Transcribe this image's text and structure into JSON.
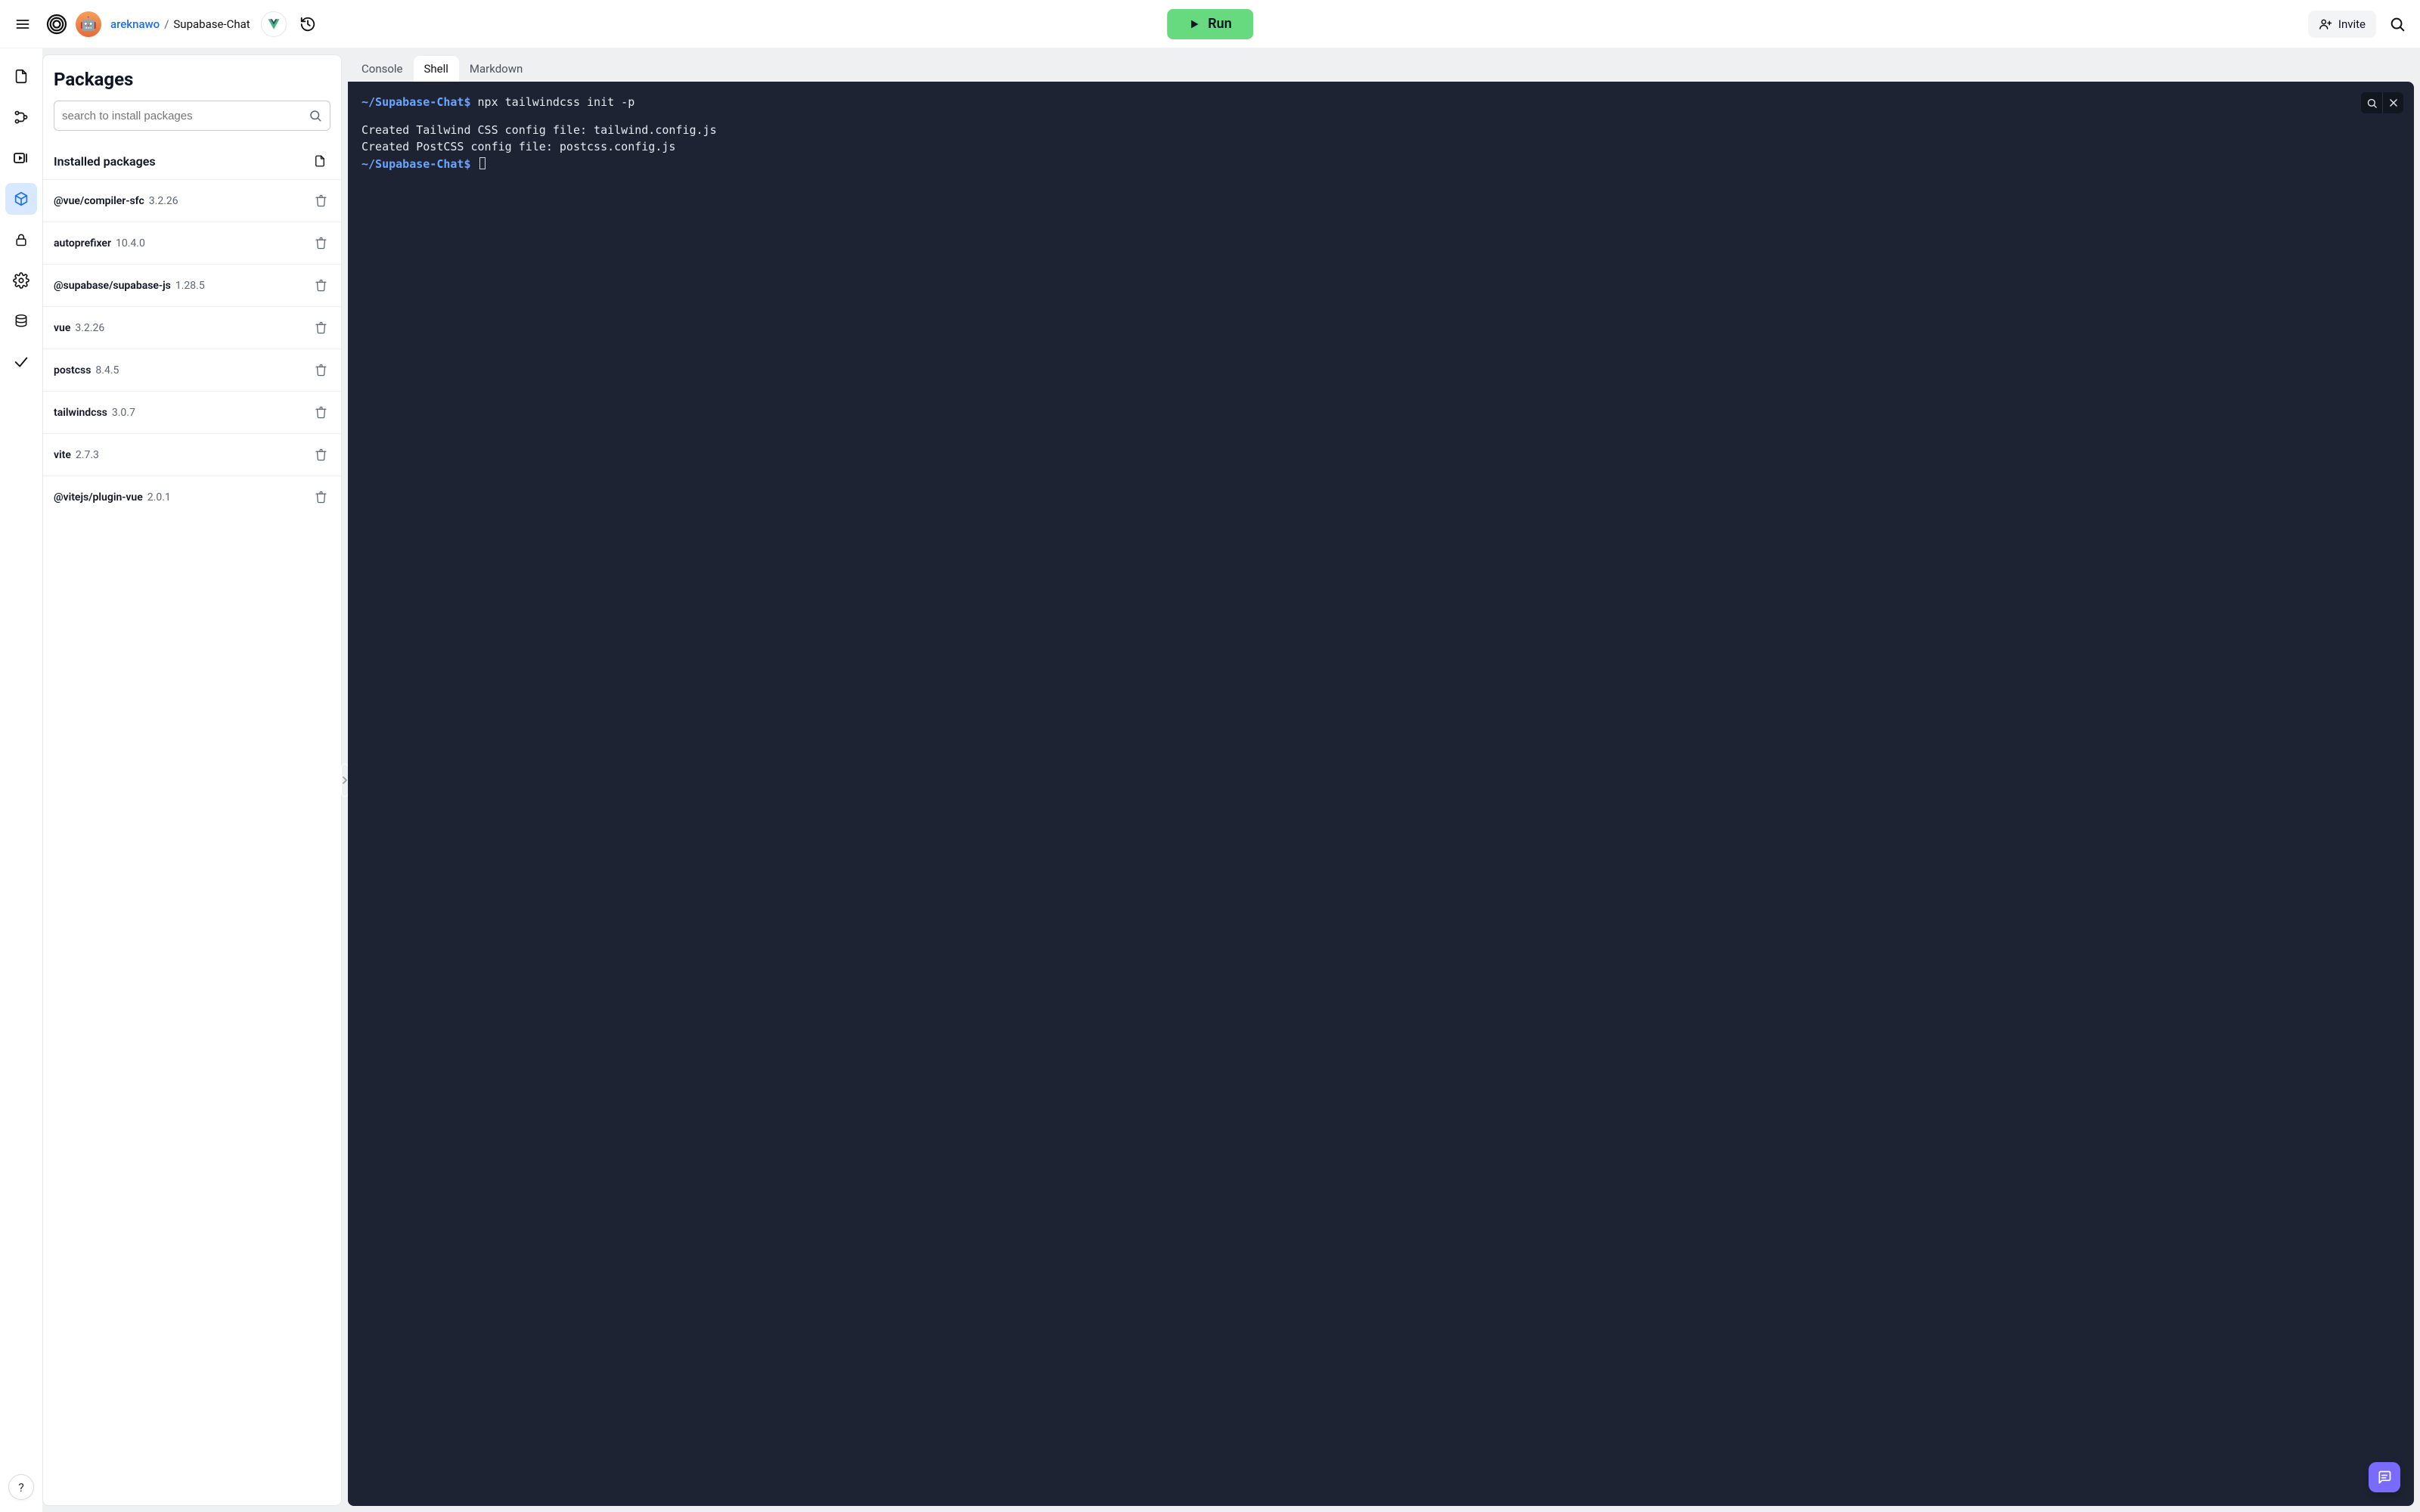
{
  "header": {
    "user": "areknawo",
    "slash": "/",
    "project": "Supabase-Chat",
    "run_label": "Run",
    "invite_label": "Invite"
  },
  "rail": {
    "items": [
      "files",
      "version-control",
      "debugger",
      "packages",
      "secrets",
      "settings",
      "database",
      "done"
    ]
  },
  "panel": {
    "title": "Packages",
    "search_placeholder": "search to install packages",
    "installed_heading": "Installed packages",
    "packages": [
      {
        "name": "@vue/compiler-sfc",
        "version": "3.2.26"
      },
      {
        "name": "autoprefixer",
        "version": "10.4.0"
      },
      {
        "name": "@supabase/supabase-js",
        "version": "1.28.5"
      },
      {
        "name": "vue",
        "version": "3.2.26"
      },
      {
        "name": "postcss",
        "version": "8.4.5"
      },
      {
        "name": "tailwindcss",
        "version": "3.0.7"
      },
      {
        "name": "vite",
        "version": "2.7.3"
      },
      {
        "name": "@vitejs/plugin-vue",
        "version": "2.0.1"
      }
    ]
  },
  "tabs": {
    "items": [
      "Console",
      "Shell",
      "Markdown"
    ],
    "active": "Shell"
  },
  "terminal": {
    "prompt_path": "~/Supabase-Chat",
    "prompt_dollar": "$",
    "command": "npx tailwindcss init -p",
    "output": [
      "Created Tailwind CSS config file: tailwind.config.js",
      "Created PostCSS config file: postcss.config.js"
    ]
  },
  "help_label": "?"
}
